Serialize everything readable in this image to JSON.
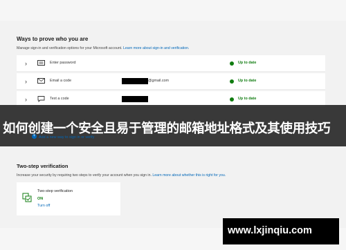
{
  "section": {
    "title": "Ways to prove who you are",
    "subtitle": "Manage sign-in and verification options for your Microsoft account. ",
    "subtitle_link": "Learn more about sign-in and verification."
  },
  "methods": [
    {
      "label": "Enter password",
      "icon": "keyboard-icon",
      "value": "",
      "status": "Up to date"
    },
    {
      "label": "Email a code",
      "icon": "mail-icon",
      "value": "@gmail.com",
      "status": "Up to date"
    },
    {
      "label": "Text a code",
      "icon": "chat-icon",
      "value": "",
      "status": "Up to date"
    }
  ],
  "add_method": "Add a new way to sign in or verify",
  "overlay_banner": "如何创建一个安全且易于管理的邮箱地址格式及其使用技巧",
  "two_step": {
    "title": "Two-step verification",
    "description": "Increase your security by requiring two steps to verify your account when you sign in. ",
    "description_link": "Learn more about whether this is right for you.",
    "card_title": "Two-step verification",
    "state": "ON",
    "action": "Turn off"
  },
  "watermark": "www.lxjinqiu.com",
  "colors": {
    "accent": "#0067b8",
    "success": "#107c10",
    "banner": "#191919"
  }
}
